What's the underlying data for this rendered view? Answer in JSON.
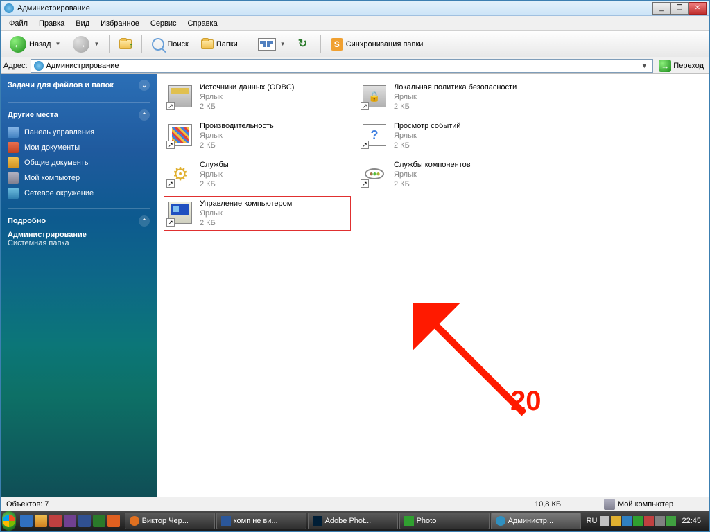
{
  "window": {
    "title": "Администрирование"
  },
  "menubar": {
    "items": [
      "Файл",
      "Правка",
      "Вид",
      "Избранное",
      "Сервис",
      "Справка"
    ]
  },
  "toolbar": {
    "back": "Назад",
    "search": "Поиск",
    "folders": "Папки",
    "sync": "Синхронизация папки"
  },
  "addressbar": {
    "label": "Адрес:",
    "value": "Администрирование",
    "go": "Переход"
  },
  "sidebar": {
    "tasks_header": "Задачи для файлов и папок",
    "places_header": "Другие места",
    "places": [
      {
        "label": "Панель управления"
      },
      {
        "label": "Мои документы"
      },
      {
        "label": "Общие документы"
      },
      {
        "label": "Мой компьютер"
      },
      {
        "label": "Сетевое окружение"
      }
    ],
    "details_header": "Подробно",
    "details_title": "Администрирование",
    "details_sub": "Системная папка"
  },
  "items": [
    {
      "title": "Источники данных (ODBC)",
      "type": "Ярлык",
      "size": "2 КБ"
    },
    {
      "title": "Локальная политика безопасности",
      "type": "Ярлык",
      "size": "2 КБ"
    },
    {
      "title": "Производительность",
      "type": "Ярлык",
      "size": "2 КБ"
    },
    {
      "title": "Просмотр событий",
      "type": "Ярлык",
      "size": "2 КБ"
    },
    {
      "title": "Службы",
      "type": "Ярлык",
      "size": "2 КБ"
    },
    {
      "title": "Службы компонентов",
      "type": "Ярлык",
      "size": "2 КБ"
    },
    {
      "title": "Управление компьютером",
      "type": "Ярлык",
      "size": "2 КБ"
    }
  ],
  "annotation": {
    "number": "20"
  },
  "statusbar": {
    "objects_label": "Объектов: 7",
    "size": "10,8 КБ",
    "location": "Мой компьютер"
  },
  "taskbar": {
    "tasks": [
      {
        "label": "Виктор Чер..."
      },
      {
        "label": "комп не ви..."
      },
      {
        "label": "Adobe Phot..."
      },
      {
        "label": "Photo"
      },
      {
        "label": "Администр..."
      }
    ],
    "lang": "RU",
    "time": "22:45"
  }
}
